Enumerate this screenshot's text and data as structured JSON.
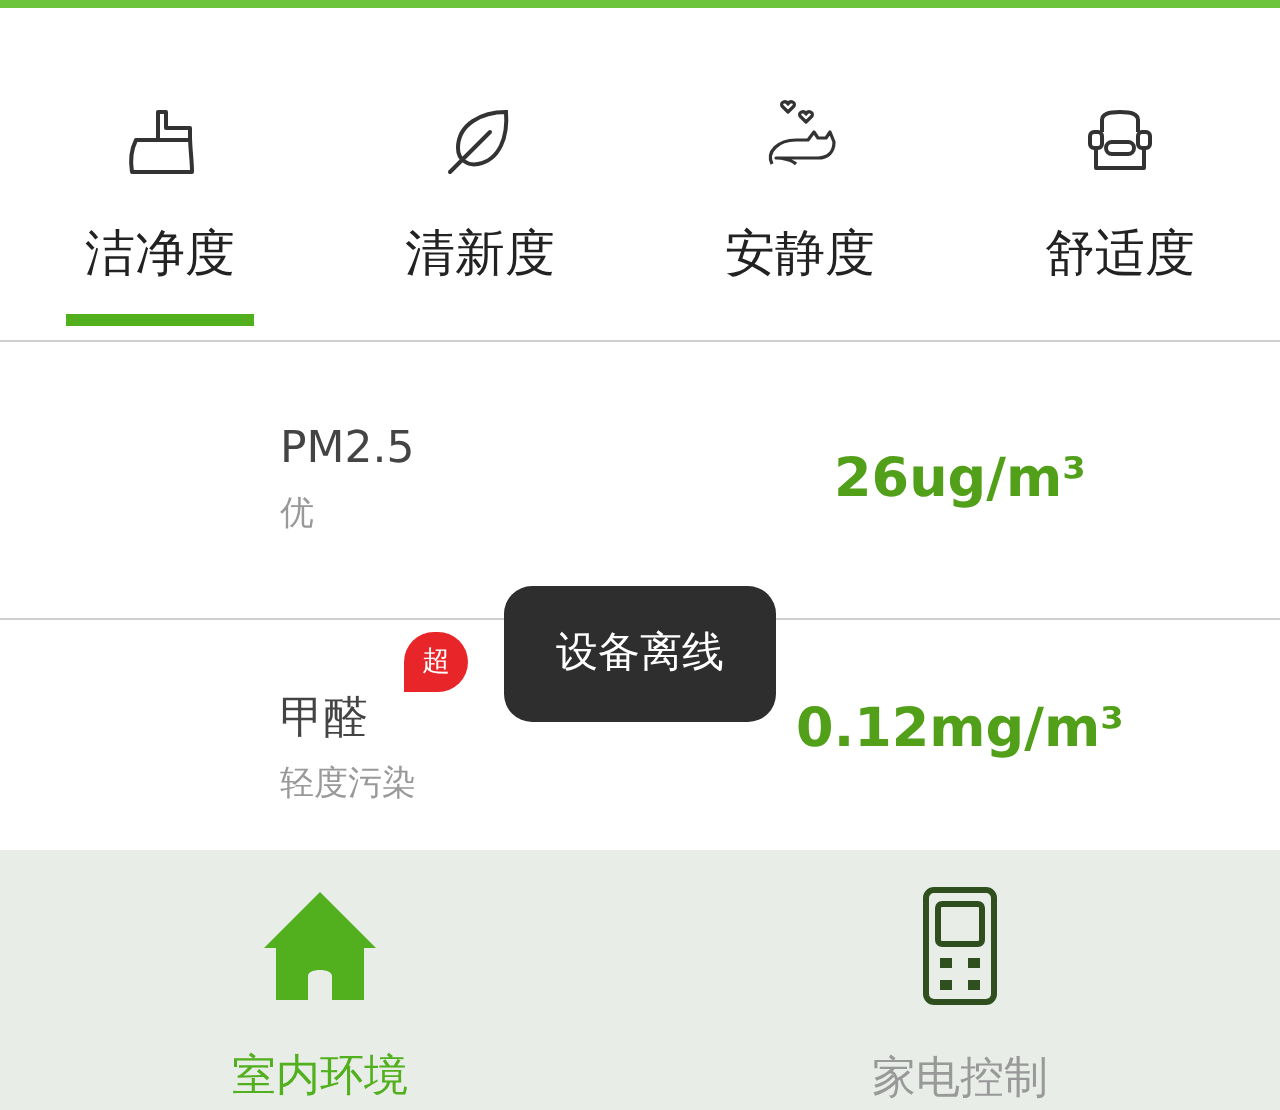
{
  "tabs": [
    {
      "label": "洁净度",
      "selected": true
    },
    {
      "label": "清新度",
      "selected": false
    },
    {
      "label": "安静度",
      "selected": false
    },
    {
      "label": "舒适度",
      "selected": false
    }
  ],
  "metrics": [
    {
      "name": "PM2.5",
      "status": "优",
      "value": "26ug/m³"
    },
    {
      "name": "甲醛",
      "status": "轻度污染",
      "value": "0.12mg/m³",
      "badge": "超"
    }
  ],
  "toast": "设备离线",
  "bottom_nav": [
    {
      "label": "室内环境",
      "selected": true
    },
    {
      "label": "家电控制",
      "selected": false
    }
  ]
}
